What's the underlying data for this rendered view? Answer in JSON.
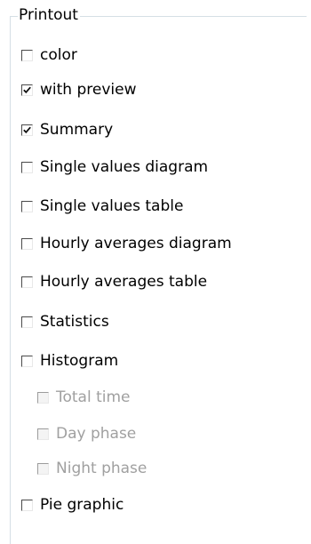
{
  "group": {
    "title": "Printout"
  },
  "options": [
    {
      "id": "color",
      "label": "color",
      "checked": false,
      "enabled": true,
      "level": 0
    },
    {
      "id": "with-preview",
      "label": "with preview",
      "checked": true,
      "enabled": true,
      "level": 0
    },
    {
      "id": "summary",
      "label": "Summary",
      "checked": true,
      "enabled": true,
      "level": 0
    },
    {
      "id": "single-values-diagram",
      "label": "Single values diagram",
      "checked": false,
      "enabled": true,
      "level": 0
    },
    {
      "id": "single-values-table",
      "label": "Single values table",
      "checked": false,
      "enabled": true,
      "level": 0
    },
    {
      "id": "hourly-averages-diagram",
      "label": "Hourly averages diagram",
      "checked": false,
      "enabled": true,
      "level": 0
    },
    {
      "id": "hourly-averages-table",
      "label": "Hourly averages table",
      "checked": false,
      "enabled": true,
      "level": 0
    },
    {
      "id": "statistics",
      "label": "Statistics",
      "checked": false,
      "enabled": true,
      "level": 0
    },
    {
      "id": "histogram",
      "label": "Histogram",
      "checked": false,
      "enabled": true,
      "level": 0
    },
    {
      "id": "total-time",
      "label": "Total time",
      "checked": false,
      "enabled": false,
      "level": 1
    },
    {
      "id": "day-phase",
      "label": "Day phase",
      "checked": false,
      "enabled": false,
      "level": 1
    },
    {
      "id": "night-phase",
      "label": "Night phase",
      "checked": false,
      "enabled": false,
      "level": 1
    },
    {
      "id": "pie-graphic",
      "label": "Pie graphic",
      "checked": false,
      "enabled": true,
      "level": 0
    }
  ]
}
